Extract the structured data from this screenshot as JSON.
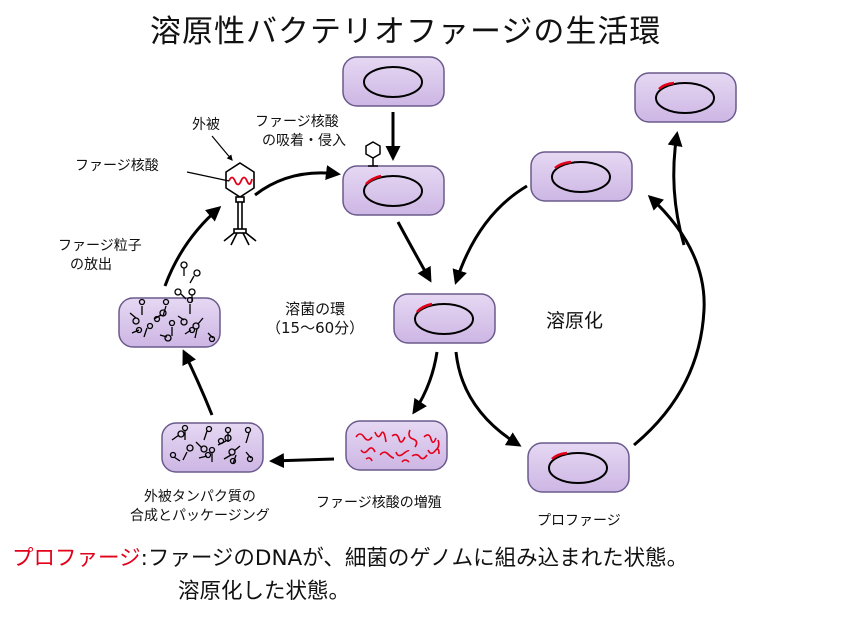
{
  "title": "溶原性バクテリオファージの生活環",
  "labels": {
    "capsid": "外被",
    "phage_nucleic_acid": "ファージ核酸",
    "adsorption_line1": "ファージ核酸",
    "adsorption_line2": "の吸着・侵入",
    "release_line1": "ファージ粒子",
    "release_line2": "の放出",
    "lytic_cycle_line1": "溶菌の環",
    "lytic_cycle_line2": "（15～60分）",
    "lysogeny": "溶原化",
    "replication": "ファージ核酸の増殖",
    "synthesis_line1": "外被タンパク質の",
    "synthesis_line2": "合成とパッケージング",
    "prophage": "プロファージ"
  },
  "note": {
    "term": "プロファージ",
    "separator": ":",
    "line1_rest": "ファージのDNAが、細菌のゲノムに組み込まれた状態。",
    "line2": "溶原化した状態。"
  },
  "colors": {
    "cell_fill": "#d9c6ec",
    "cell_stroke": "#6a5a8c",
    "phage_dna": "#e3001b",
    "arrow": "#000000",
    "accent_text": "#e3001b"
  }
}
